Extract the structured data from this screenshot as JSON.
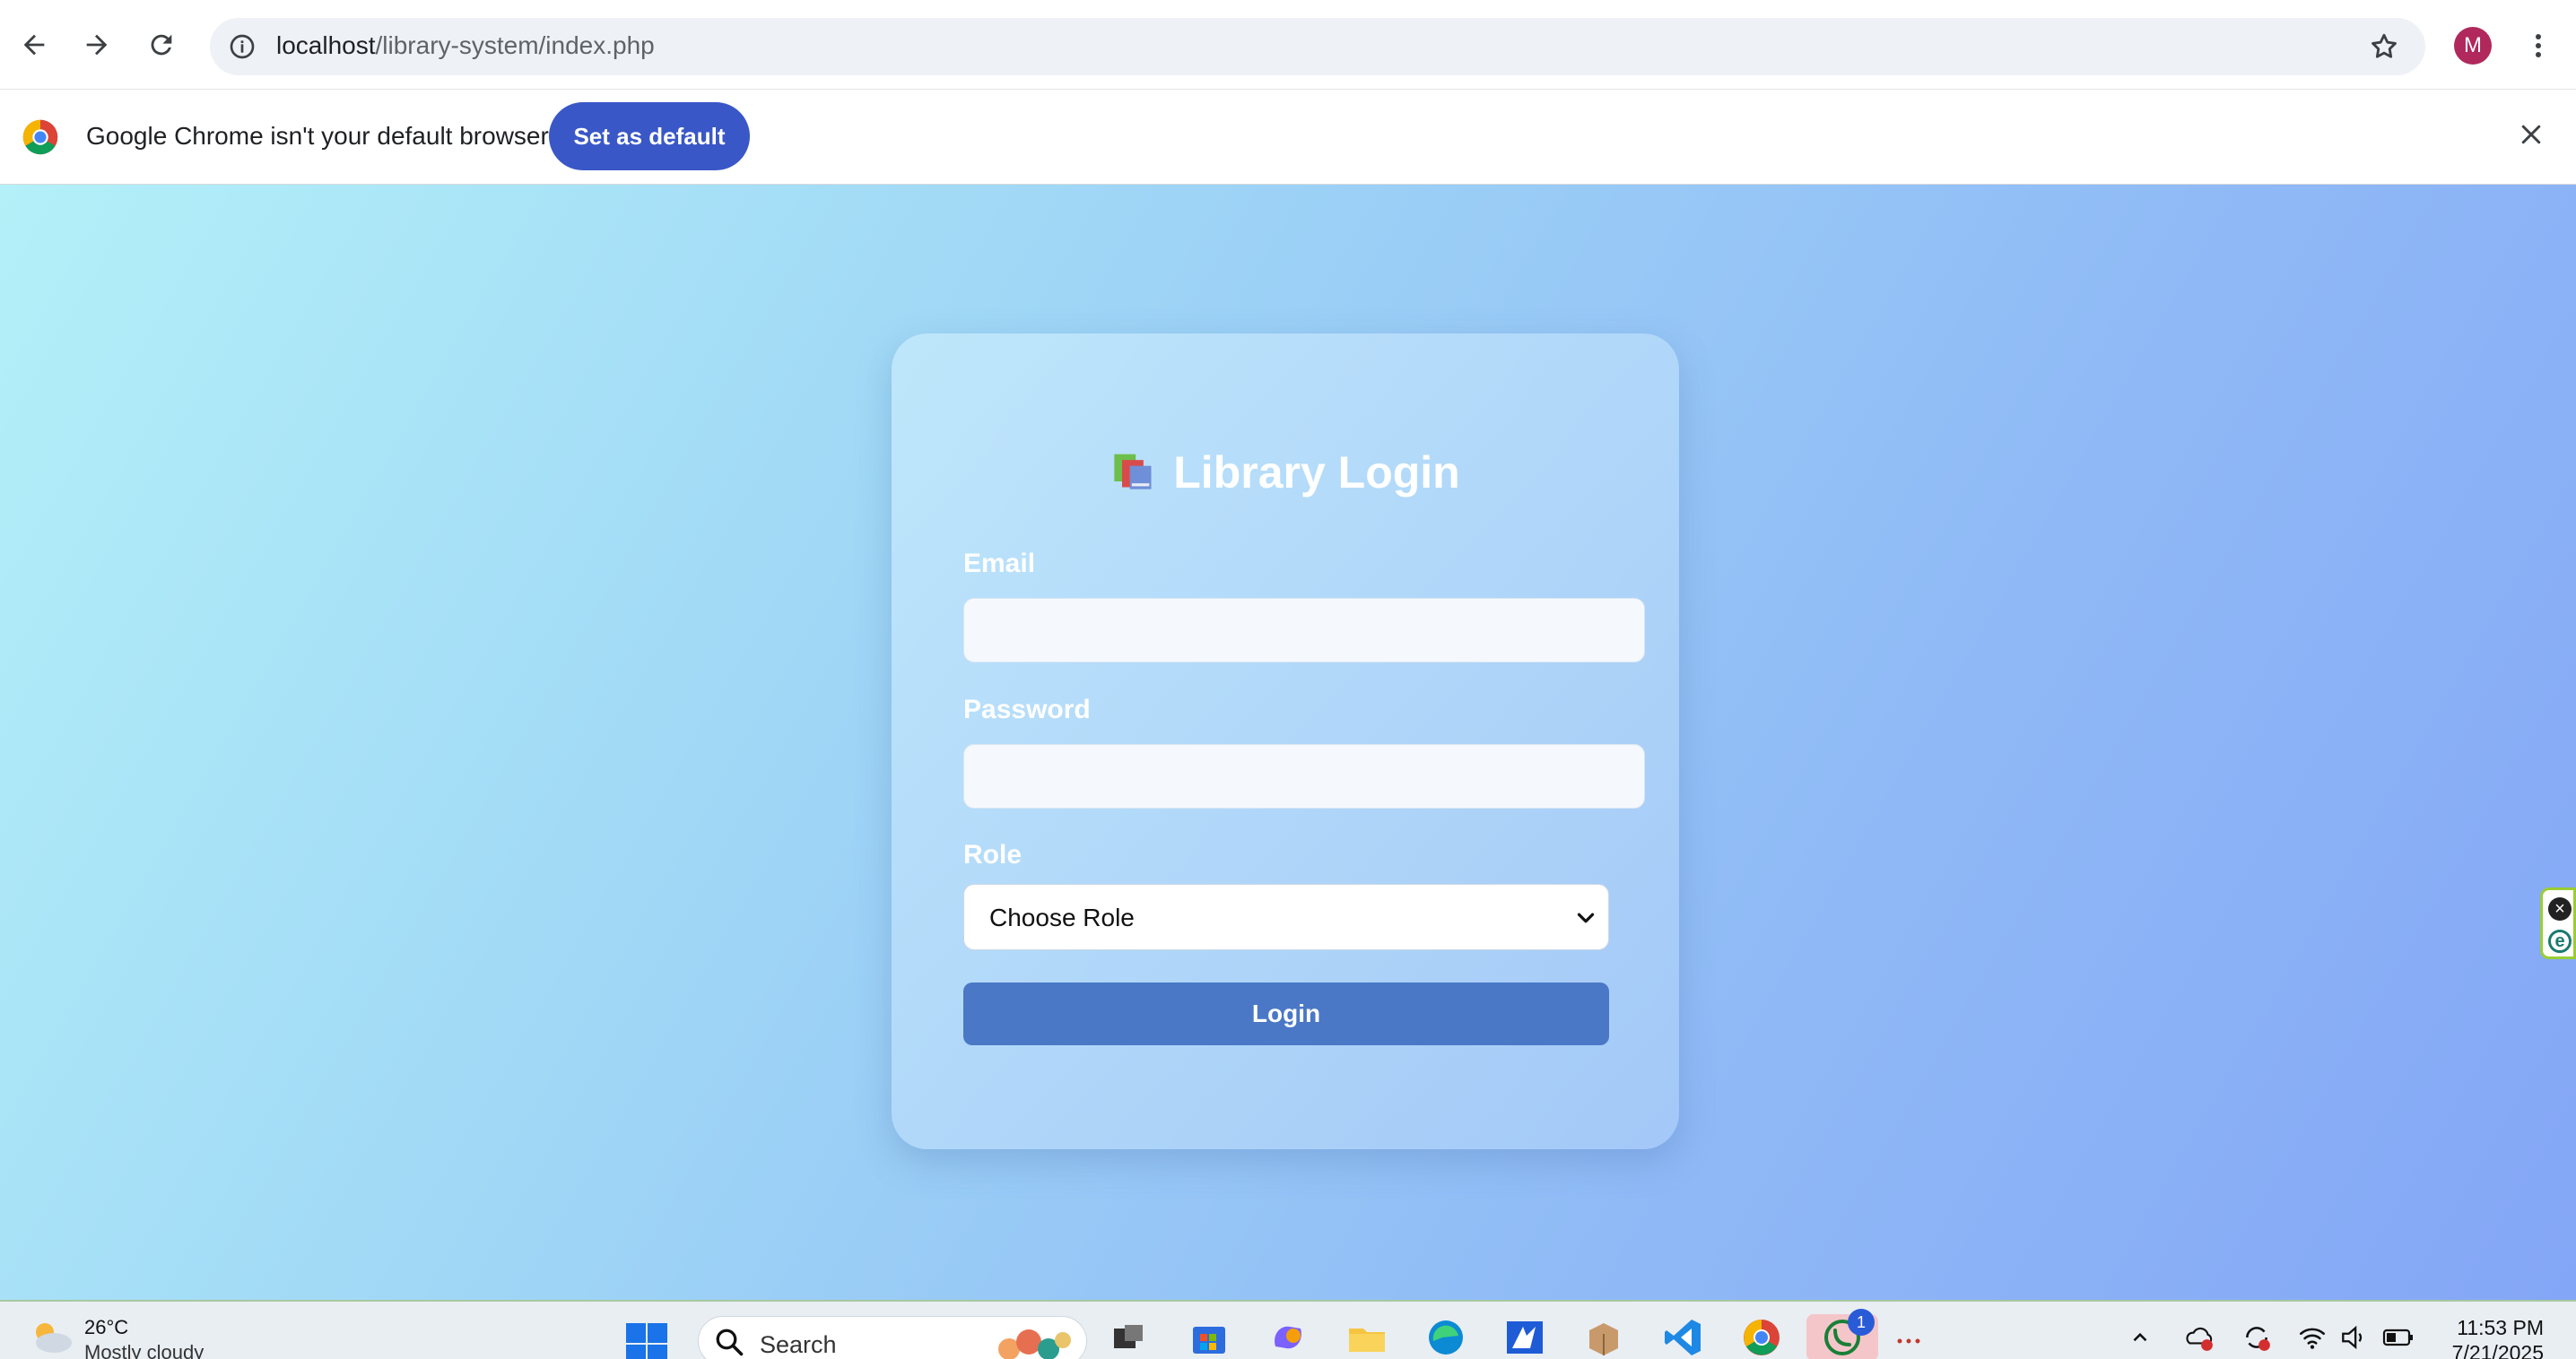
{
  "browser": {
    "url_host": "localhost",
    "url_path": "/library-system/index.php",
    "profile_initial": "M",
    "colors": {
      "accent": "#3a57c7",
      "profile": "#b0285c"
    }
  },
  "infobar": {
    "message": "Google Chrome isn't your default browser",
    "set_default_label": "Set as default"
  },
  "login": {
    "title": "Library Login",
    "title_icon": "books-icon",
    "email_label": "Email",
    "email_value": "",
    "password_label": "Password",
    "password_value": "",
    "role_label": "Role",
    "role_selected": "Choose Role",
    "submit_label": "Login",
    "colors": {
      "button": "#4a78c6",
      "gradient_start": "#b3f0f8",
      "gradient_end": "#84a6f6"
    }
  },
  "taskbar": {
    "weather_temp": "26°C",
    "weather_desc": "Mostly cloudy",
    "search_placeholder": "Search",
    "notification_badge": "1",
    "time": "11:53 PM",
    "date": "7/21/2025"
  }
}
